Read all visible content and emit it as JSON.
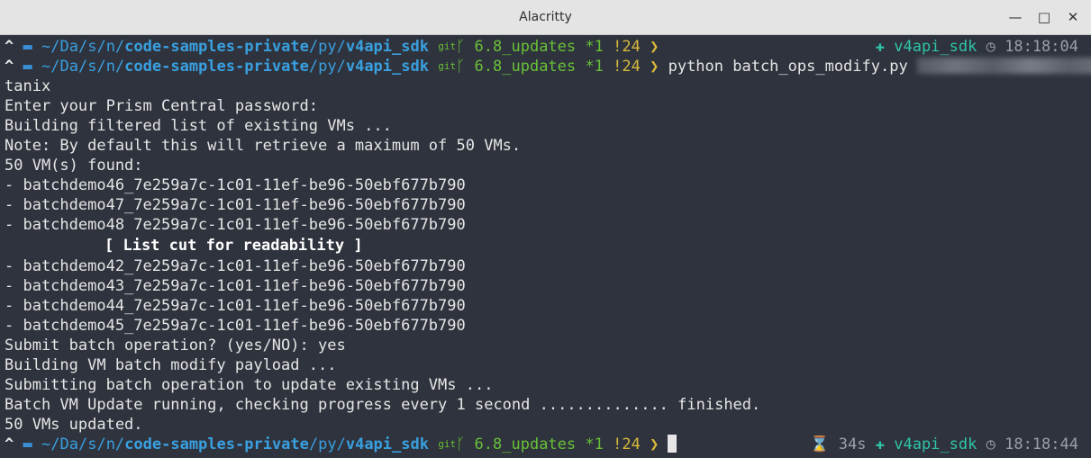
{
  "window": {
    "title": "Alacritty",
    "minimize_glyph": "—",
    "maximize_glyph": "□",
    "close_glyph": "✕"
  },
  "prompt": {
    "arrow": "^",
    "home": "~/",
    "seg1": "Da/",
    "seg2": "s/",
    "seg3": "n/",
    "repo": "code-samples-private",
    "slash1": "/",
    "seg4": "py/",
    "project": "v4api_sdk",
    "git_label": "git",
    "branch_icon": "ᚴ",
    "branch": "6.8_updates",
    "modified": "*1",
    "untracked": "!24",
    "chevron": "❯"
  },
  "right_prompt_1": {
    "venv_icon": "✚",
    "venv": "v4api_sdk",
    "clock_icon": "◷",
    "time": "18:18:04"
  },
  "command": "python batch_ops_modify.py",
  "output": {
    "l1": "tanix",
    "l2": "Enter your Prism Central password:",
    "l3": "Building filtered list of existing VMs ...",
    "l4": "Note: By default this will retrieve a maximum of 50 VMs.",
    "l5": "50 VM(s) found:",
    "l6": "- batchdemo46_7e259a7c-1c01-11ef-be96-50ebf677b790",
    "l7": "- batchdemo47_7e259a7c-1c01-11ef-be96-50ebf677b790",
    "l8": "- batchdemo48 7e259a7c-1c01-11ef-be96-50ebf677b790",
    "cut": "[ List cut for readability ]",
    "l9": "- batchdemo42_7e259a7c-1c01-11ef-be96-50ebf677b790",
    "l10": "- batchdemo43_7e259a7c-1c01-11ef-be96-50ebf677b790",
    "l11": "- batchdemo44_7e259a7c-1c01-11ef-be96-50ebf677b790",
    "l12": "- batchdemo45_7e259a7c-1c01-11ef-be96-50ebf677b790",
    "l13": "Submit batch operation? (yes/NO): yes",
    "l14": "Building VM batch modify payload ...",
    "l15": "Submitting batch operation to update existing VMs ...",
    "l16": "Batch VM Update running, checking progress every 1 second .............. finished.",
    "l17": "50 VMs updated."
  },
  "right_prompt_2": {
    "hourglass_icon": "⌛",
    "duration": "34s",
    "venv_icon": "✚",
    "venv": "v4api_sdk",
    "clock_icon": "◷",
    "time": "18:18:44"
  }
}
